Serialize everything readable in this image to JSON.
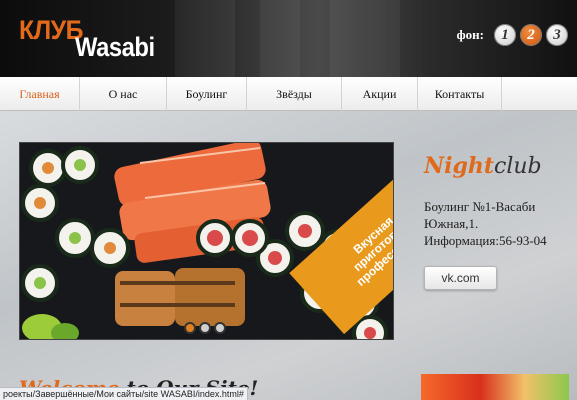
{
  "header": {
    "logo_club": "КЛУБ",
    "logo_wasabi": "Wasabi",
    "bg_label": "фон:",
    "bg_buttons": [
      "1",
      "2",
      "3"
    ],
    "bg_active": "2"
  },
  "nav": {
    "items": [
      "Главная",
      "О нас",
      "Боулинг",
      "Звёзды",
      "Акции",
      "Контакты"
    ],
    "active": "Главная"
  },
  "slider": {
    "ribbon_lines": [
      "Вкусная еда",
      "приготовленная",
      "профессионалами"
    ],
    "dots_count": 3,
    "active_dot": 1
  },
  "sidebar": {
    "title_part1": "Night",
    "title_part2": "club",
    "info_line1": "Боулинг №1-Васаби",
    "info_line2": "Южная,1.",
    "info_line3": "Информация:56-93-04",
    "vk_label": "vk.com"
  },
  "welcome": {
    "part1": "Welcome",
    "part2": " to Our Site!"
  },
  "statusbar": {
    "text": "роекты/Завершённые/Мои сайты/site WASABI/index.html#"
  },
  "colors": {
    "accent": "#e06a1c",
    "ribbon": "#e99a1d"
  }
}
